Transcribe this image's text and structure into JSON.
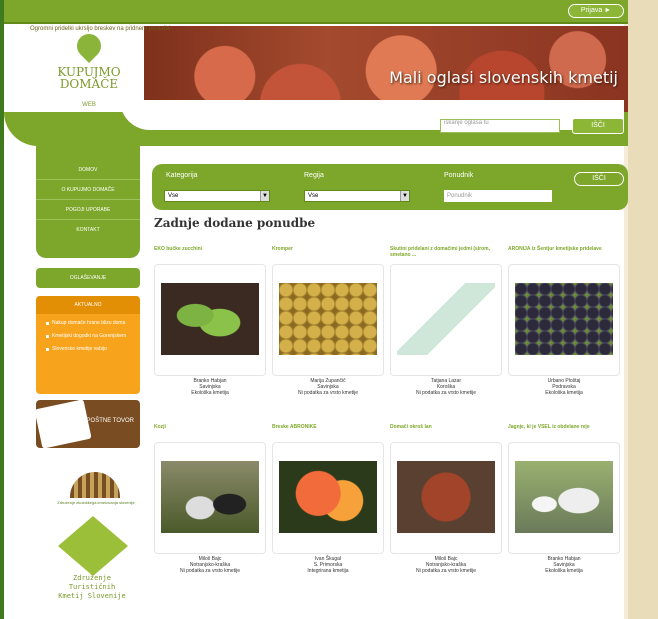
{
  "topbar": {
    "login_label": "Prijava ►",
    "notice": "Ogromni pridelki ukrsljo breskev na pridnem ponudbi"
  },
  "header": {
    "title": "Mali oglasi slovenskih kmetij"
  },
  "logo": {
    "line1": "KUPUJMO",
    "line2": "DOMAČE",
    "sub": "WEB"
  },
  "search": {
    "placeholder": "iskanje oglasa tu",
    "button": "IŠČI"
  },
  "left_nav": {
    "items": [
      "DOMOV",
      "O KUPUJMO DOMAČE",
      "POGOJI UPORABE",
      "KONTAKT"
    ]
  },
  "left_box2": {
    "label": "OGLAŠEVANJE"
  },
  "info_box": {
    "title": "AKTUALNO",
    "items": [
      "Nakup domače hrane blizu doma",
      "Kmetijski dogodki na Gorenjskem",
      "Slovenske kmetije vabijo"
    ]
  },
  "promo": {
    "label": "POŠTNE TOVOR"
  },
  "logo2": {
    "text": "Združenje ekološkega kmetovanja slovenije"
  },
  "logo3": {
    "line1": "Združenje",
    "line2": "Turističnih",
    "line3": "Kmetij Slovenije"
  },
  "filter": {
    "category_label": "Kategorija",
    "category_value": "Vse",
    "region_label": "Regija",
    "region_value": "Vse",
    "offer_label": "Ponudnik",
    "offer_placeholder": "Ponudnik",
    "button": "IŠČI"
  },
  "section_title": "Zadnje dodane ponudbe",
  "cards": [
    {
      "title": "EKO bučke zucchini",
      "seller": "Branko Habjan",
      "place": "Savinjska",
      "type": "Ekološka kmetija",
      "img": "zucchini"
    },
    {
      "title": "Kromper",
      "seller": "Marija Zupančič",
      "place": "Savinjska",
      "type": "Ni podatka za vrsto kmetije",
      "img": "beans"
    },
    {
      "title": "Skutini pridelani z domačimi jedmi (sirom, smetano ...",
      "seller": "Tatjana Lazar",
      "place": "Koroška",
      "type": "Ni podatka za vrsto kmetije",
      "img": "cheese"
    },
    {
      "title": "ARONIJA iz Šentjur kmetijske pridelave",
      "seller": "Urbano Ploštaj",
      "place": "Podravska",
      "type": "Ekološka kmetija",
      "img": "aronia"
    },
    {
      "title": "Kozji",
      "seller": "Miloš Bajc",
      "place": "Notranjsko-kraška",
      "type": "Ni podatka za vrsto kmetije",
      "img": "goats"
    },
    {
      "title": "Breske ABRONIKE",
      "seller": "Ivan Škugal",
      "place": "S. Primorska",
      "type": "Integrirana kmetija",
      "img": "peaches"
    },
    {
      "title": "Domači okroš lan",
      "seller": "Miloš Bajc",
      "place": "Notranjsko-kraška",
      "type": "Ni podatka za vrsto kmetije",
      "img": "bush"
    },
    {
      "title": "Jagnje, ki je VSEL iz obdelane reje",
      "seller": "Branko Habjan",
      "place": "Savinjska",
      "type": "Ekološka kmetija",
      "img": "sheep"
    }
  ]
}
